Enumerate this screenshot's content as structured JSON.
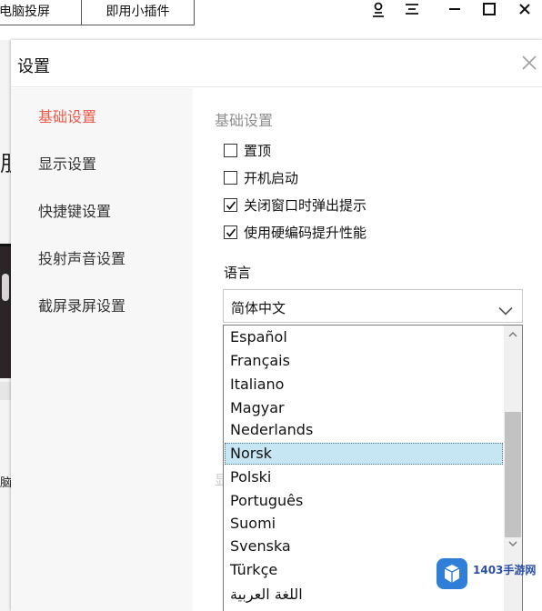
{
  "topbar": {
    "tab_screen_cast": "电脑投屏",
    "tab_plugin": "即用小插件",
    "icons": [
      "user-icon",
      "menu-icon",
      "minimize-icon",
      "maximize-icon",
      "close-icon"
    ]
  },
  "background": {
    "partial_char_top": "朋",
    "partial_char_bottom": "脑"
  },
  "dialog": {
    "title": "设置",
    "nav": [
      {
        "label": "基础设置",
        "active": true
      },
      {
        "label": "显示设置",
        "active": false
      },
      {
        "label": "快捷键设置",
        "active": false
      },
      {
        "label": "投射声音设置",
        "active": false
      },
      {
        "label": "截屏录屏设置",
        "active": false
      }
    ],
    "section_title": "基础设置",
    "checkboxes": [
      {
        "label": "置顶",
        "checked": false
      },
      {
        "label": "开机启动",
        "checked": false
      },
      {
        "label": "关闭窗口时弹出提示",
        "checked": true
      },
      {
        "label": "使用硬编码提升性能",
        "checked": true
      }
    ],
    "language_label": "语言",
    "language_selected": "简体中文",
    "faded_char": "显"
  },
  "dropdown": {
    "options": [
      "Español",
      "Français",
      "Italiano",
      "Magyar",
      "Nederlands",
      "Norsk",
      "Polski",
      "Português",
      "Suomi",
      "Svenska",
      "Türkçe",
      "اللغة العربية"
    ],
    "highlighted": "Norsk"
  },
  "watermark": {
    "text": "1403手游网"
  },
  "colors": {
    "accent_active_nav": "#ea5a4a",
    "selection_bg": "#c6e6f3",
    "section_title": "#8e8e8e"
  }
}
